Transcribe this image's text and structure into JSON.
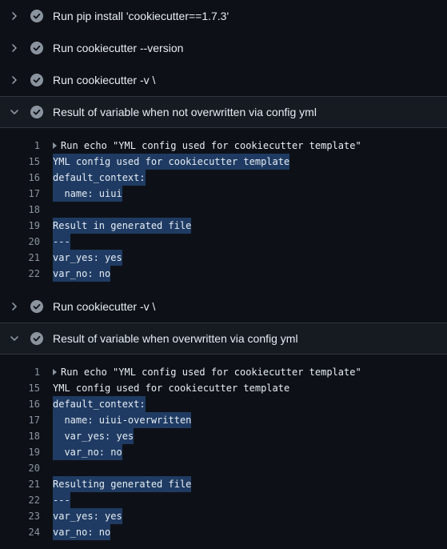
{
  "steps": [
    {
      "title": "Run pip install 'cookiecutter==1.7.3'",
      "expanded": false
    },
    {
      "title": "Run cookiecutter --version",
      "expanded": false
    },
    {
      "title": "Run cookiecutter -v \\",
      "expanded": false
    },
    {
      "title": "Result of variable when not overwritten via config yml",
      "expanded": true,
      "lines": [
        {
          "n": "1",
          "text": "Run echo \"YML config used for cookiecutter template\"",
          "collapsed_group": true,
          "highlight": false
        },
        {
          "n": "15",
          "text": "YML config used for cookiecutter template",
          "highlight": true
        },
        {
          "n": "16",
          "text": "default_context:",
          "highlight": true
        },
        {
          "n": "17",
          "text": "  name: uiui",
          "highlight": true
        },
        {
          "n": "18",
          "text": "",
          "highlight": false
        },
        {
          "n": "19",
          "text": "Result in generated file",
          "highlight": true
        },
        {
          "n": "20",
          "text": "---",
          "highlight": true
        },
        {
          "n": "21",
          "text": "var_yes: yes",
          "highlight": true
        },
        {
          "n": "22",
          "text": "var_no: no",
          "highlight": true
        }
      ]
    },
    {
      "title": "Run cookiecutter -v \\",
      "expanded": false
    },
    {
      "title": "Result of variable when overwritten via config yml",
      "expanded": true,
      "lines": [
        {
          "n": "1",
          "text": "Run echo \"YML config used for cookiecutter template\"",
          "collapsed_group": true,
          "highlight": false
        },
        {
          "n": "15",
          "text": "YML config used for cookiecutter template",
          "highlight": false
        },
        {
          "n": "16",
          "text": "default_context:",
          "highlight": true
        },
        {
          "n": "17",
          "text": "  name: uiui-overwritten",
          "highlight": true
        },
        {
          "n": "18",
          "text": "  var_yes: yes",
          "highlight": true
        },
        {
          "n": "19",
          "text": "  var_no: no",
          "highlight": true
        },
        {
          "n": "20",
          "text": "",
          "highlight": false
        },
        {
          "n": "21",
          "text": "Resulting generated file",
          "highlight": true
        },
        {
          "n": "22",
          "text": "---",
          "highlight": true
        },
        {
          "n": "23",
          "text": "var_yes: yes",
          "highlight": true
        },
        {
          "n": "24",
          "text": "var_no: no",
          "highlight": true
        }
      ]
    }
  ],
  "icons": {
    "collapsed": "chevron-right-icon",
    "expanded": "chevron-down-icon",
    "status": "check-circle-icon"
  },
  "colors": {
    "background": "#0d1117",
    "expanded_header": "#161b22",
    "highlight": "#1f3b63",
    "line_number": "#8b949e",
    "check_fill": "#8b949e"
  }
}
